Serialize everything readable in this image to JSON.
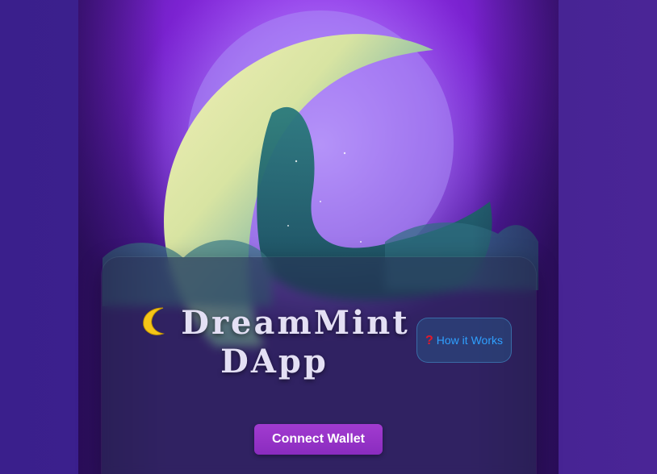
{
  "app": {
    "title_emoji_icon": "crescent-moon-icon",
    "title": "DreamMint DApp"
  },
  "help": {
    "icon": "question-mark-icon",
    "label": "How it Works"
  },
  "wallet": {
    "connect_label": "Connect Wallet"
  },
  "colors": {
    "accent": "#9333c9",
    "link": "#2fa0ff",
    "title_text": "#e4e0f4",
    "background": "#3f2290"
  }
}
